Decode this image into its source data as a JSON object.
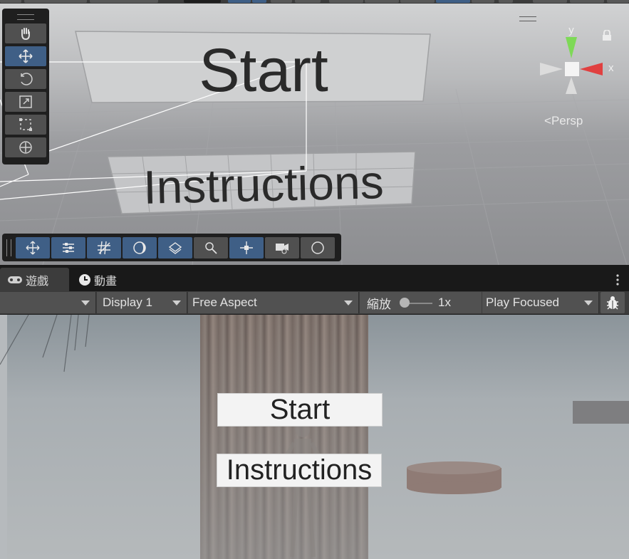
{
  "scene": {
    "start_text": "Start",
    "instructions_text": "Instructions",
    "persp_label": "Persp",
    "gizmo": {
      "y_label": "y",
      "x_label": "x"
    },
    "tools": [
      "hand-tool",
      "move-tool",
      "rotate-tool",
      "scale-tool",
      "rect-tool",
      "transform-tool"
    ],
    "active_tool": "move-tool",
    "overlay_buttons": [
      "move",
      "snap-settings",
      "grid",
      "shading",
      "layers",
      "search",
      "center",
      "camera",
      "gizmo"
    ]
  },
  "tabs": {
    "game_label": "遊戲",
    "animation_label": "動畫"
  },
  "game_toolbar": {
    "display": "Display 1",
    "aspect": "Free Aspect",
    "zoom_label": "縮放",
    "zoom_value": "1x",
    "play_mode": "Play Focused"
  },
  "game": {
    "start_label": "Start",
    "instructions_label": "Instructions"
  },
  "colors": {
    "accent": "#3f5f86",
    "panel": "#1f1f1f",
    "gizmo_y": "#7ed957",
    "gizmo_x": "#e04040"
  }
}
